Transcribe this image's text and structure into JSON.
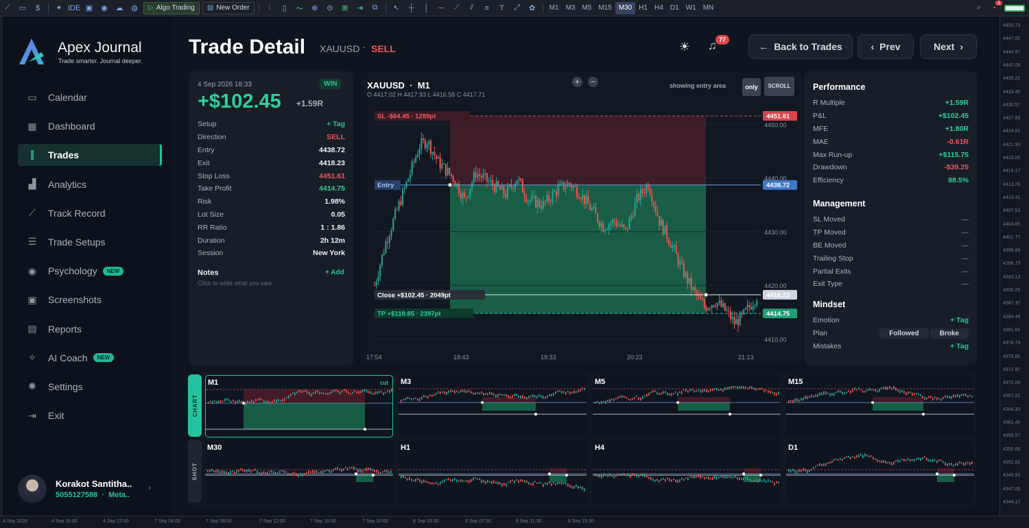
{
  "toolbar": {
    "algo_trading": "Algo Trading",
    "new_order": "New Order",
    "ide": "IDE",
    "timeframes": [
      "M1",
      "M3",
      "M5",
      "M15",
      "M30",
      "H1",
      "H4",
      "D1",
      "W1",
      "MN"
    ],
    "active_timeframe": "M30",
    "alert_count": "1"
  },
  "right_axis": [
    "4450.73",
    "4447.02",
    "4444.97",
    "4442.09",
    "4439.21",
    "4433.45",
    "4430.57",
    "4427.69",
    "4424.81",
    "4421.93",
    "4419.05",
    "4416.17",
    "4413.29",
    "4410.41",
    "4407.53",
    "4404.65",
    "4401.77",
    "4398.89",
    "4396.73",
    "4393.13",
    "4390.25",
    "4387.37",
    "4384.49",
    "4381.61",
    "4378.73",
    "4375.85",
    "4372.97",
    "4370.09",
    "4367.21",
    "4364.33",
    "4361.45",
    "4358.57",
    "4355.69",
    "4352.81",
    "4349.93",
    "4347.05",
    "4344.17"
  ],
  "bottom_axis": [
    "4 Sep 2026",
    "4 Sep 16:00",
    "4 Sep 22:00",
    "7 Sep 04:00",
    "7 Sep 08:00",
    "7 Sep 12:00",
    "7 Sep 16:00",
    "7 Sep 20:00",
    "8 Sep 03:30",
    "8 Sep 07:30",
    "8 Sep 11:30",
    "8 Sep 15:30"
  ],
  "brand": {
    "name": "Apex Journal",
    "tagline": "Trade smarter. Journal deeper."
  },
  "nav": [
    {
      "label": "Calendar",
      "icon": "calendar-icon"
    },
    {
      "label": "Dashboard",
      "icon": "grid-icon"
    },
    {
      "label": "Trades",
      "icon": "candles-icon",
      "active": true
    },
    {
      "label": "Analytics",
      "icon": "bars-icon"
    },
    {
      "label": "Track Record",
      "icon": "trend-icon"
    },
    {
      "label": "Trade Setups",
      "icon": "sliders-icon"
    },
    {
      "label": "Psychology",
      "icon": "target-icon",
      "badge": "NEW"
    },
    {
      "label": "Screenshots",
      "icon": "image-icon"
    },
    {
      "label": "Reports",
      "icon": "document-icon"
    },
    {
      "label": "AI Coach",
      "icon": "sparkle-icon",
      "badge": "NEW"
    },
    {
      "label": "Settings",
      "icon": "gear-icon"
    },
    {
      "label": "Exit",
      "icon": "exit-icon"
    }
  ],
  "user": {
    "name": "Korakot Santitha..",
    "account": "5055127588",
    "platform": "Meta.."
  },
  "header": {
    "title": "Trade Detail",
    "symbol": "XAUUSD",
    "separator": "·",
    "direction": "SELL",
    "notifications": "77",
    "back_label": "Back to Trades",
    "prev_label": "Prev",
    "next_label": "Next"
  },
  "detail": {
    "datetime": "4 Sep 2026 18:33",
    "result": "WIN",
    "pnl": "+$102.45",
    "r": "+1.59R",
    "rows": [
      {
        "k": "Setup",
        "v": "+ Tag",
        "c": "#25c2a0"
      },
      {
        "k": "Direction",
        "v": "SELL",
        "c": "#f0555c"
      },
      {
        "k": "Entry",
        "v": "4438.72",
        "c": "#eef2f6"
      },
      {
        "k": "Exit",
        "v": "4418.23",
        "c": "#eef2f6"
      },
      {
        "k": "Stop Loss",
        "v": "4451.61",
        "c": "#f0555c"
      },
      {
        "k": "Take Profit",
        "v": "4414.75",
        "c": "#2ed09d"
      },
      {
        "k": "Risk",
        "v": "1.98%",
        "c": "#eef2f6"
      },
      {
        "k": "Lot Size",
        "v": "0.05",
        "c": "#eef2f6"
      },
      {
        "k": "RR Ratio",
        "v": "1 : 1.86",
        "c": "#eef2f6"
      },
      {
        "k": "Duration",
        "v": "2h 12m",
        "c": "#eef2f6"
      },
      {
        "k": "Session",
        "v": "New York",
        "c": "#eef2f6"
      }
    ],
    "notes_title": "Notes",
    "notes_add": "+ Add",
    "notes_placeholder": "Click to write what you saw"
  },
  "chart": {
    "symbol": "XAUUSD",
    "timeframe": "M1",
    "ohlc": "O 4417.02   H 4417.93   L 4416.58   C 4417.71",
    "showing_label": "showing entry area",
    "only_label": "only",
    "scroll_label": "SCROLL"
  },
  "chart_data": {
    "type": "candlestick",
    "x_ticks": [
      "17:54",
      "18:43",
      "19:33",
      "20:23",
      "21:13"
    ],
    "y_ticks": [
      4450.0,
      4440.0,
      4430.0,
      4420.0,
      4410.0
    ],
    "ylim": [
      4408.5,
      4452.5
    ],
    "levels": {
      "sl": {
        "label": "SL   -$64.45  ·  1289pt",
        "price": 4451.61,
        "price_label": "4451.61"
      },
      "entry": {
        "label": "Entry",
        "price": 4438.72,
        "price_label": "4438.72"
      },
      "close": {
        "label": "Close   +$102.45  ·  2049pt",
        "price": 4418.23,
        "price_label": "4418.23"
      },
      "tp": {
        "label": "TP   +$119.85  ·  2397pt",
        "price": 4414.75,
        "price_label": "4414.75"
      }
    },
    "path": [
      [
        0,
        4420
      ],
      [
        6,
        4428
      ],
      [
        12,
        4434
      ],
      [
        18,
        4440
      ],
      [
        24,
        4446
      ],
      [
        28,
        4447
      ],
      [
        34,
        4443
      ],
      [
        42,
        4440
      ],
      [
        48,
        4436
      ],
      [
        54,
        4441
      ],
      [
        62,
        4439
      ],
      [
        70,
        4437
      ],
      [
        76,
        4440
      ],
      [
        82,
        4436
      ],
      [
        90,
        4435
      ],
      [
        98,
        4438
      ],
      [
        104,
        4439
      ],
      [
        110,
        4437
      ],
      [
        116,
        4434
      ],
      [
        122,
        4431
      ],
      [
        128,
        4432
      ],
      [
        134,
        4430
      ],
      [
        140,
        4436
      ],
      [
        146,
        4439
      ],
      [
        152,
        4432
      ],
      [
        158,
        4428
      ],
      [
        164,
        4423
      ],
      [
        170,
        4419
      ],
      [
        176,
        4416
      ],
      [
        182,
        4417
      ],
      [
        188,
        4415
      ],
      [
        192,
        4413
      ],
      [
        196,
        4414
      ],
      [
        200,
        4416
      ],
      [
        204,
        4418
      ]
    ],
    "colors": {
      "up": "#26a69a",
      "down": "#ef5350",
      "risk": "#7a2030",
      "reward": "#1d7a56"
    }
  },
  "performance": {
    "title": "Performance",
    "rows": [
      {
        "k": "R Multiple",
        "v": "+1.59R",
        "c": "#2ed09d"
      },
      {
        "k": "P&L",
        "v": "+$102.45",
        "c": "#2ed09d"
      },
      {
        "k": "MFE",
        "v": "+1.80R",
        "c": "#2ed09d"
      },
      {
        "k": "MAE",
        "v": "-0.61R",
        "c": "#f0555c"
      },
      {
        "k": "Max Run-up",
        "v": "+$115.75",
        "c": "#2ed09d"
      },
      {
        "k": "Drawdown",
        "v": "-$39.25",
        "c": "#f0555c"
      },
      {
        "k": "Efficiency",
        "v": "88.5%",
        "c": "#2ed09d"
      }
    ],
    "management_title": "Management",
    "management": [
      {
        "k": "SL Moved",
        "v": "—"
      },
      {
        "k": "TP Moved",
        "v": "—"
      },
      {
        "k": "BE Moved",
        "v": "—"
      },
      {
        "k": "Trailing Stop",
        "v": "—"
      },
      {
        "k": "Partial Exits",
        "v": "—"
      },
      {
        "k": "Exit Type",
        "v": "—"
      }
    ],
    "mindset_title": "Mindset",
    "emotion_label": "Emotion",
    "emotion_value": "+ Tag",
    "plan_label": "Plan",
    "plan_options": [
      "Followed",
      "Broke"
    ],
    "mistakes_label": "Mistakes",
    "mistakes_value": "+ Tag"
  },
  "strip": {
    "chart_tab": "CHART",
    "shot_tab": "SHOT",
    "cut_label": "cut",
    "thumbnails": [
      "M1",
      "M3",
      "M5",
      "M15",
      "M30",
      "H1",
      "H4",
      "D1"
    ]
  }
}
